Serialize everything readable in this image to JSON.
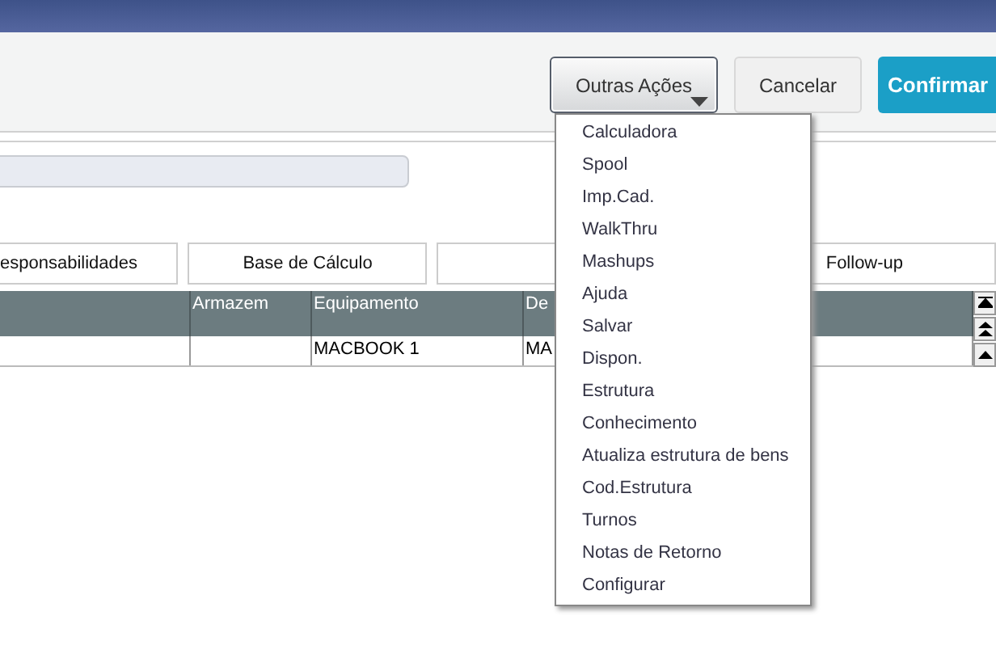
{
  "toolbar": {
    "buttons": [
      {
        "label": "Outras Ações",
        "kind": "dropdown",
        "expanded": true
      },
      {
        "label": "Cancelar",
        "kind": "plain"
      },
      {
        "label": "Confirmar",
        "kind": "primary"
      }
    ]
  },
  "tabs": [
    {
      "label": "esponsabilidades",
      "kind": "text"
    },
    {
      "label": "Base de Cálculo",
      "kind": "text"
    },
    {
      "kind": "blank"
    },
    {
      "label": "Follow-up",
      "kind": "text"
    }
  ],
  "table": {
    "columns": [
      "",
      "Armazem",
      "Equipamento",
      "De"
    ],
    "rows": [
      [
        "",
        "",
        "MACBOOK 1",
        "MA"
      ]
    ]
  },
  "menu": {
    "items": [
      "Calculadora",
      "Spool",
      "Imp.Cad.",
      "WalkThru",
      "Mashups",
      "Ajuda",
      "Salvar",
      "Dispon.",
      "Estrutura",
      "Conhecimento",
      "Atualiza estrutura de bens",
      "Cod.Estrutura",
      "Turnos",
      "Notas de Retorno",
      "Configurar"
    ]
  }
}
